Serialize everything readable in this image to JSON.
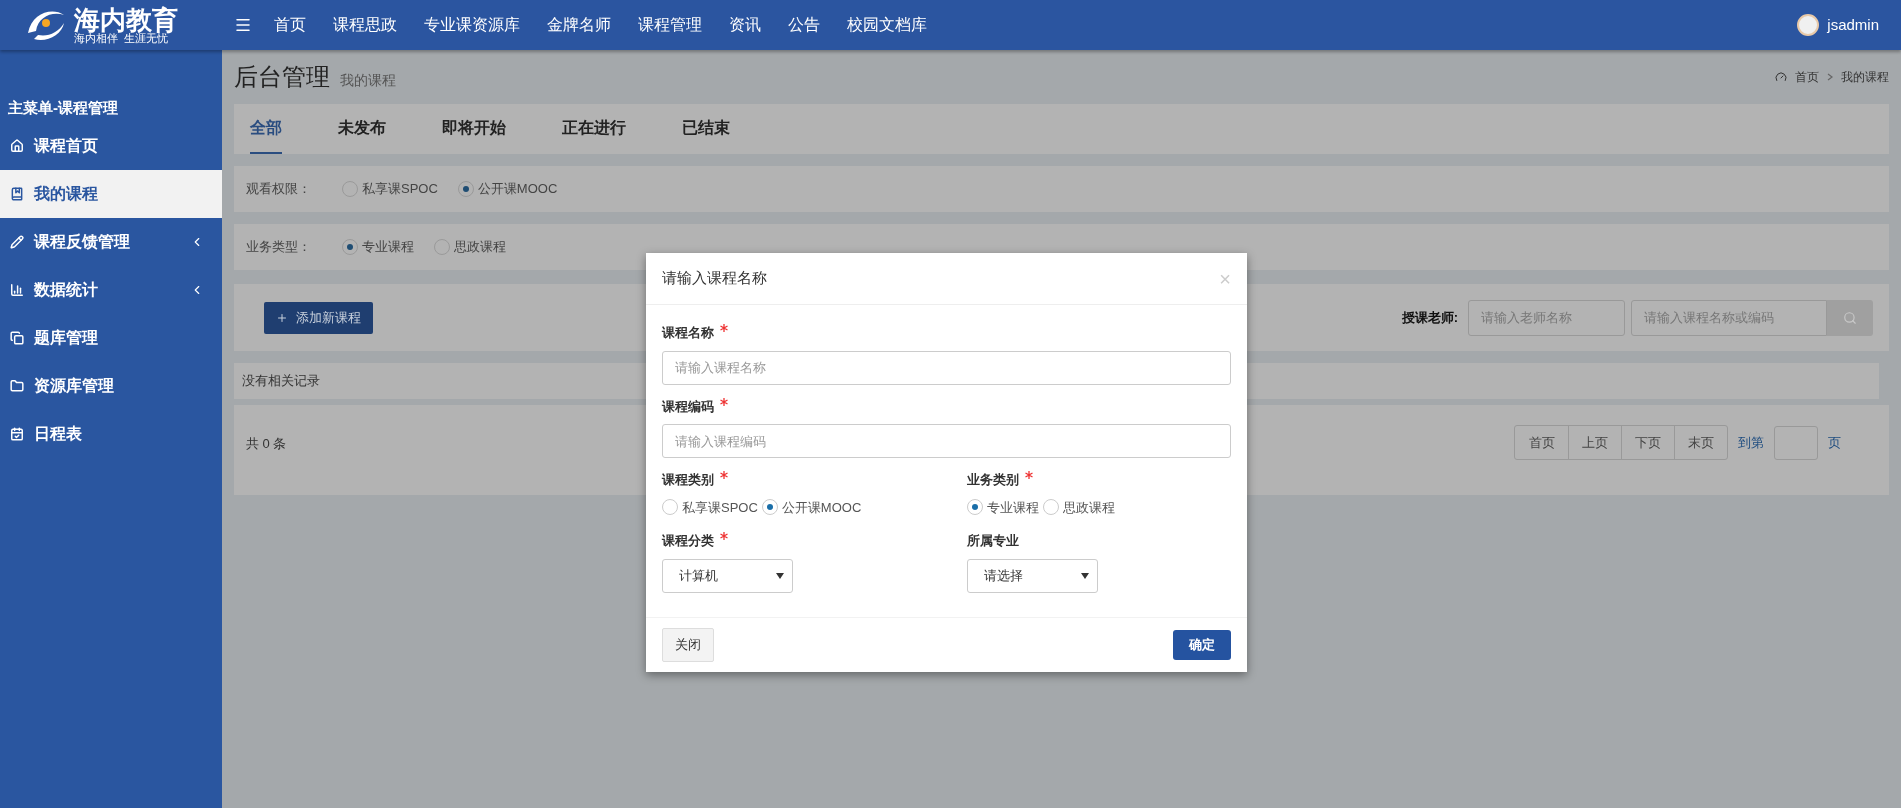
{
  "header": {
    "logo_title": "海内教育",
    "logo_slogan": "海内相伴  生涯无忧",
    "nav": [
      "首页",
      "课程思政",
      "专业课资源库",
      "金牌名师",
      "课程管理",
      "资讯",
      "公告",
      "校园文档库"
    ],
    "user": "jsadmin"
  },
  "sidebar": {
    "title": "主菜单-课程管理",
    "items": [
      {
        "label": "课程首页",
        "selected": false,
        "has_submenu": false
      },
      {
        "label": "我的课程",
        "selected": true,
        "has_submenu": false
      },
      {
        "label": "课程反馈管理",
        "selected": false,
        "has_submenu": true
      },
      {
        "label": "数据统计",
        "selected": false,
        "has_submenu": true
      },
      {
        "label": "题库管理",
        "selected": false,
        "has_submenu": false
      },
      {
        "label": "资源库管理",
        "selected": false,
        "has_submenu": false
      },
      {
        "label": "日程表",
        "selected": false,
        "has_submenu": false
      }
    ]
  },
  "page": {
    "title": "后台管理",
    "subtitle": "我的课程",
    "breadcrumb": [
      "首页",
      "我的课程"
    ]
  },
  "tabs": [
    {
      "label": "全部",
      "selected": true
    },
    {
      "label": "未发布",
      "selected": false
    },
    {
      "label": "即将开始",
      "selected": false
    },
    {
      "label": "正在进行",
      "selected": false
    },
    {
      "label": "已结束",
      "selected": false
    }
  ],
  "filters": [
    {
      "label": "观看权限：",
      "options": [
        {
          "label": "私享课SPOC",
          "selected": false
        },
        {
          "label": "公开课MOOC",
          "selected": true
        }
      ]
    },
    {
      "label": "业务类型：",
      "options": [
        {
          "label": "专业课程",
          "selected": true
        },
        {
          "label": "思政课程",
          "selected": false
        }
      ]
    }
  ],
  "toolbar": {
    "add_button": "添加新课程",
    "teacher_label": "授课老师:",
    "teacher_placeholder": "请输入老师名称",
    "search_placeholder": "请输入课程名称或编码"
  },
  "empty_message": "没有相关记录",
  "pager": {
    "total": "共 0 条",
    "buttons": [
      "首页",
      "上页",
      "下页",
      "末页"
    ],
    "goto": "到第",
    "page_suffix": "页"
  },
  "dialog": {
    "title": "请输入课程名称",
    "close": "×",
    "text_fields": [
      {
        "label": "课程名称",
        "required": true,
        "placeholder": "请输入课程名称"
      },
      {
        "label": "课程编码",
        "required": true,
        "placeholder": "请输入课程编码"
      }
    ],
    "radio_groups": [
      {
        "label": "课程类别",
        "required": true,
        "options": [
          {
            "label": "私享课SPOC",
            "selected": false
          },
          {
            "label": "公开课MOOC",
            "selected": true
          }
        ]
      },
      {
        "label": "业务类别",
        "required": true,
        "options": [
          {
            "label": "专业课程",
            "selected": true
          },
          {
            "label": "思政课程",
            "selected": false
          }
        ]
      }
    ],
    "selects": [
      {
        "label": "课程分类",
        "required": true,
        "value": "计算机"
      },
      {
        "label": "所属专业",
        "required": false,
        "value": "请选择"
      }
    ],
    "cancel_button": "关闭",
    "confirm_button": "确定"
  }
}
